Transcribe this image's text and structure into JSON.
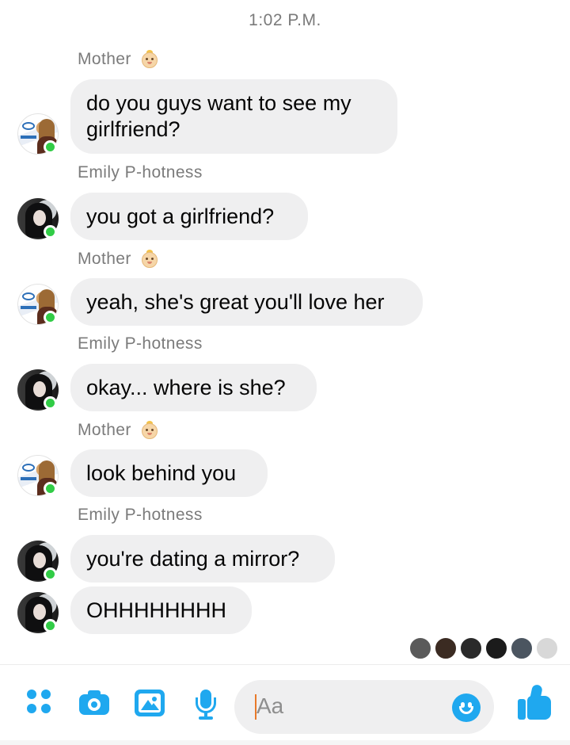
{
  "timestamp": "1:02 P.M.",
  "messages": [
    {
      "sender": "Mother",
      "avatar": "mother",
      "text": "do you guys want to see my girlfriend?"
    },
    {
      "sender": "Emily P-hotness",
      "avatar": "emily",
      "text": "you got a girlfriend?"
    },
    {
      "sender": "Mother",
      "avatar": "mother",
      "text": "yeah, she's great you'll love her"
    },
    {
      "sender": "Emily P-hotness",
      "avatar": "emily",
      "text": "okay... where is she?"
    },
    {
      "sender": "Mother",
      "avatar": "mother",
      "text": "look behind you"
    },
    {
      "sender": "Emily P-hotness",
      "avatar": "emily",
      "text": "you're dating a mirror?"
    },
    {
      "sender": "Emily P-hotness",
      "avatar": "emily",
      "text": "OHHHHHHHH"
    }
  ],
  "composer": {
    "placeholder": "Aa",
    "icons": [
      "apps-icon",
      "camera-icon",
      "image-icon",
      "microphone-icon",
      "emoji-icon",
      "thumbs-up-icon"
    ]
  },
  "colors": {
    "accent": "#1fa8ef",
    "bubble": "#efeff0",
    "online": "#31cc46"
  }
}
